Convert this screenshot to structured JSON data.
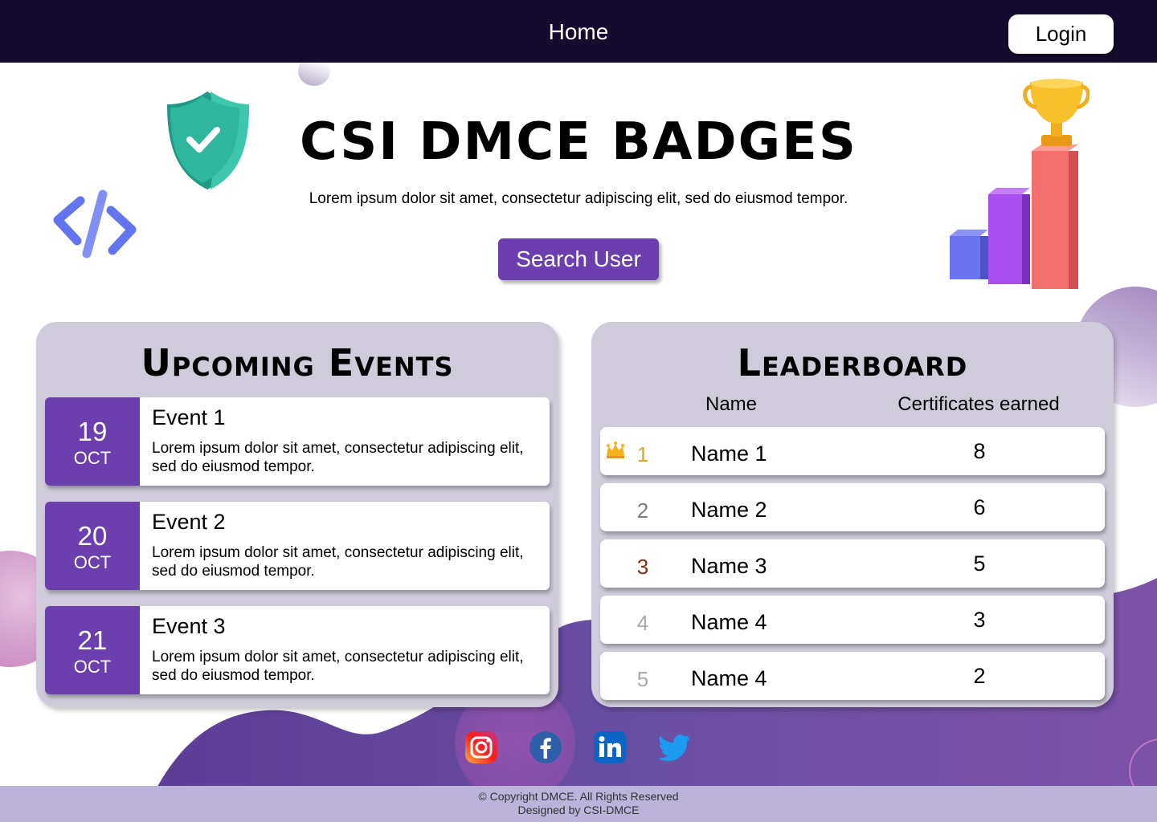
{
  "nav": {
    "home": "Home",
    "login": "Login"
  },
  "hero": {
    "title": "CSI DMCE BADGES",
    "subtitle": "Lorem ipsum dolor sit amet, consectetur adipiscing elit, sed do eiusmod tempor.",
    "search_button": "Search User"
  },
  "events": {
    "title": "Upcoming Events",
    "items": [
      {
        "day": "19",
        "month": "OCT",
        "name": "Event 1",
        "description": "Lorem ipsum dolor sit amet, consectetur adipiscing elit, sed do eiusmod tempor."
      },
      {
        "day": "20",
        "month": "OCT",
        "name": "Event 2",
        "description": "Lorem ipsum dolor sit amet, consectetur adipiscing elit, sed do eiusmod tempor."
      },
      {
        "day": "21",
        "month": "OCT",
        "name": "Event 3",
        "description": "Lorem ipsum dolor sit amet, consectetur adipiscing elit, sed do eiusmod tempor."
      }
    ]
  },
  "leaderboard": {
    "title": "Leaderboard",
    "columns": {
      "name": "Name",
      "certificates": "Certificates earned"
    },
    "rows": [
      {
        "rank": "1",
        "name": "Name 1",
        "certificates": "8",
        "rank_color": "#e0a418",
        "icon": "crown-icon"
      },
      {
        "rank": "2",
        "name": "Name 2",
        "certificates": "6",
        "rank_color": "#7d7d7d"
      },
      {
        "rank": "3",
        "name": "Name 3",
        "certificates": "5",
        "rank_color": "#8b2a0e"
      },
      {
        "rank": "4",
        "name": "Name 4",
        "certificates": "3",
        "rank_color": "#a9a9a9"
      },
      {
        "rank": "5",
        "name": "Name 4",
        "certificates": "2",
        "rank_color": "#a9a9a9"
      }
    ]
  },
  "social": [
    "instagram-icon",
    "facebook-icon",
    "linkedin-icon",
    "twitter-icon"
  ],
  "footer": {
    "copyright": "© Copyright DMCE. All Rights Reserved",
    "designed_by": "Designed by  CSI-DMCE"
  },
  "colors": {
    "navbar": "#150b2e",
    "accent": "#6b3fad",
    "card": "#cfcbda",
    "footer": "#bbb3d9"
  }
}
